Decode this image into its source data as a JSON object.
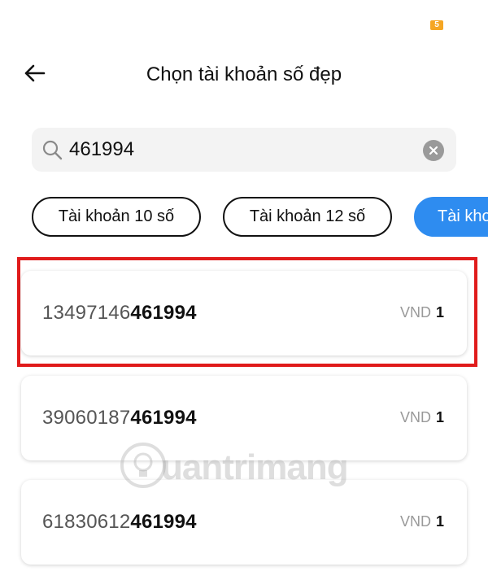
{
  "status_bar": {
    "badge": "5"
  },
  "header": {
    "title": "Chọn tài khoản số đẹp"
  },
  "search": {
    "value": "461994"
  },
  "chips": [
    {
      "label": "Tài khoản 10 số"
    },
    {
      "label": "Tài khoản 12 số"
    },
    {
      "label": "Tài khoản"
    }
  ],
  "accounts": [
    {
      "prefix": "13497146",
      "suffix": "461994",
      "currency": "VND",
      "amount": "1"
    },
    {
      "prefix": "39060187",
      "suffix": "461994",
      "currency": "VND",
      "amount": "1"
    },
    {
      "prefix": "61830612",
      "suffix": "461994",
      "currency": "VND",
      "amount": "1"
    }
  ],
  "watermark": {
    "text": "uantrimang"
  },
  "colors": {
    "accent": "#2e8cf0",
    "highlight": "#e01b1b",
    "badge": "#f5a623"
  }
}
